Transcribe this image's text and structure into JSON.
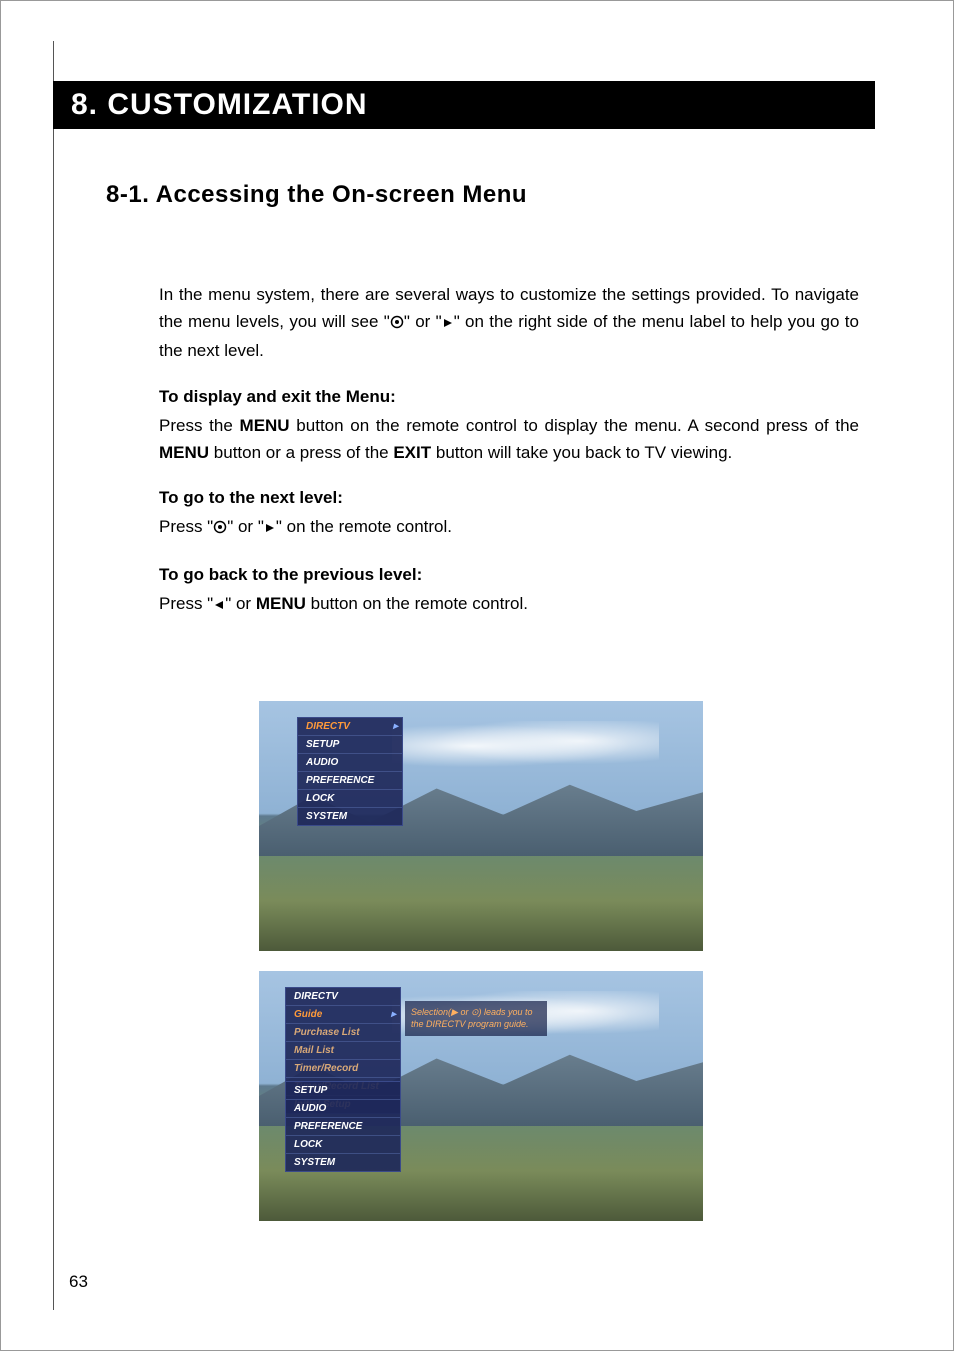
{
  "chapter": {
    "title": "8. CUSTOMIZATION"
  },
  "section": {
    "title": "8-1. Accessing the On-screen Menu"
  },
  "para_intro_a": "In the menu system, there are several ways to customize the settings provided. To navigate the menu levels, you will see \"",
  "para_intro_b": "\" or \"",
  "para_intro_c": "\" on the right side of the menu label to help you go to the next level.",
  "sub1_title": "To display and exit the Menu:",
  "sub1_a": "Press the ",
  "sub1_b": " button on the remote control to display the menu.  A second press of the ",
  "sub1_c": " button or a press of the ",
  "sub1_d": " button will take you back to TV viewing.",
  "menu_word": "MENU",
  "exit_word": "EXIT",
  "sub2_title": "To go to the next level:",
  "sub2_a": "Press \"",
  "sub2_b": "\" or \"",
  "sub2_c": "\" on the remote control.",
  "sub3_title": "To go back to the previous level:",
  "sub3_a": "Press \"",
  "sub3_b": "\" or ",
  "sub3_c": " button on the remote control.",
  "page_number": "63",
  "screenshot1": {
    "items": [
      "DIRECTV",
      "SETUP",
      "AUDIO",
      "PREFERENCE",
      "LOCK",
      "SYSTEM"
    ],
    "active_index": 0
  },
  "screenshot2": {
    "header": "DIRECTV",
    "sub_items": [
      "Guide",
      "Purchase List",
      "Mail List",
      "Timer/Record",
      "Timer/Record List",
      "Initial Setup"
    ],
    "sub_active_index": 0,
    "footer_items": [
      "SETUP",
      "AUDIO",
      "PREFERENCE",
      "LOCK",
      "SYSTEM"
    ],
    "desc": "Selection(▶ or ⊙) leads you to the DIRECTV program guide."
  }
}
